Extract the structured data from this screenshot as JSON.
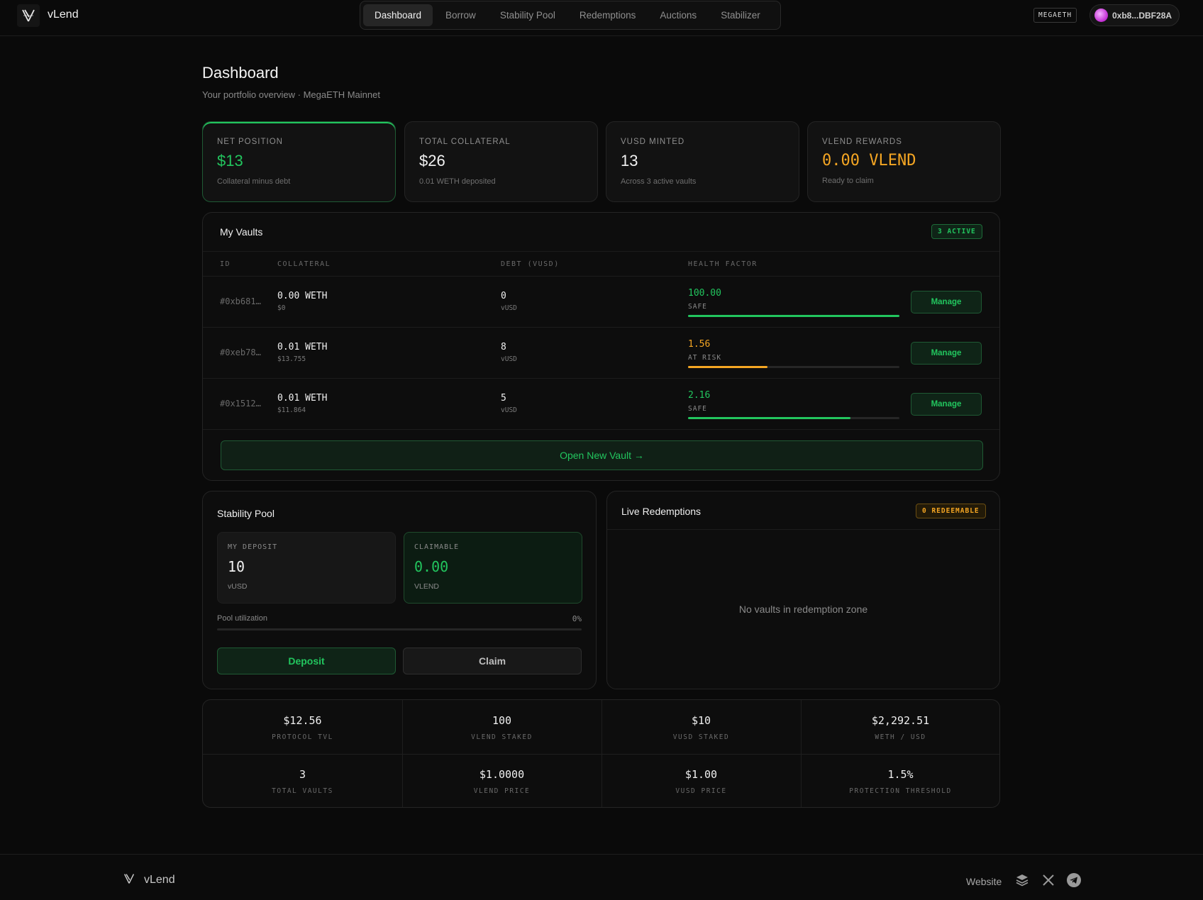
{
  "header": {
    "brand": "vLend",
    "nav": [
      "Dashboard",
      "Borrow",
      "Stability Pool",
      "Redemptions",
      "Auctions",
      "Stabilizer"
    ],
    "network": "MEGAETH",
    "wallet": "0xb8...DBF28A"
  },
  "page": {
    "title": "Dashboard",
    "subtitle": "Your portfolio overview · MegaETH Mainnet"
  },
  "cards": [
    {
      "label": "NET POSITION",
      "value": "$13",
      "sub": "Collateral minus debt"
    },
    {
      "label": "TOTAL COLLATERAL",
      "value": "$26",
      "sub": "0.01 WETH deposited"
    },
    {
      "label": "VUSD MINTED",
      "value": "13",
      "sub": "Across 3 active vaults"
    },
    {
      "label": "VLEND REWARDS",
      "value": "0.00 VLEND",
      "sub": "Ready to claim"
    }
  ],
  "vaults": {
    "title": "My Vaults",
    "badge": "3 ACTIVE",
    "columns": [
      "ID",
      "COLLATERAL",
      "DEBT (VUSD)",
      "HEALTH FACTOR"
    ],
    "rows": [
      {
        "id": "#0xb681…",
        "collateral": "0.00 WETH",
        "collateral_usd": "$0",
        "debt": "0",
        "debt_unit": "vUSD",
        "hf": "100.00",
        "status": "SAFE",
        "hf_fill": 1.0,
        "action": "Manage"
      },
      {
        "id": "#0xeb78…",
        "collateral": "0.01 WETH",
        "collateral_usd": "$13.755",
        "debt": "8",
        "debt_unit": "vUSD",
        "hf": "1.56",
        "status": "AT RISK",
        "hf_fill": 0.375,
        "action": "Manage"
      },
      {
        "id": "#0x1512…",
        "collateral": "0.01 WETH",
        "collateral_usd": "$11.864",
        "debt": "5",
        "debt_unit": "vUSD",
        "hf": "2.16",
        "status": "SAFE",
        "hf_fill": 0.77,
        "action": "Manage"
      }
    ],
    "open_button": "Open New Vault →"
  },
  "pool": {
    "title": "Stability Pool",
    "deposit_label": "MY DEPOSIT",
    "deposit_value": "10",
    "deposit_unit": "vUSD",
    "claim_label": "CLAIMABLE",
    "claim_value": "0.00",
    "claim_unit": "VLEND",
    "util_label": "Pool utilization",
    "util_value": "0%",
    "util_fill": 0,
    "deposit_btn": "Deposit",
    "claim_btn": "Claim"
  },
  "redemptions": {
    "title": "Live Redemptions",
    "badge": "0 REDEEMABLE",
    "empty": "No vaults in redemption zone"
  },
  "stats": [
    {
      "value": "$12.56",
      "label": "PROTOCOL TVL"
    },
    {
      "value": "100",
      "label": "VLEND STAKED"
    },
    {
      "value": "$10",
      "label": "VUSD STAKED"
    },
    {
      "value": "$2,292.51",
      "label": "WETH / USD"
    },
    {
      "value": "3",
      "label": "TOTAL VAULTS"
    },
    {
      "value": "$1.0000",
      "label": "VLEND PRICE"
    },
    {
      "value": "$1.00",
      "label": "VUSD PRICE"
    },
    {
      "value": "1.5%",
      "label": "PROTECTION THRESHOLD"
    }
  ],
  "footer": {
    "brand": "vLend",
    "website": "Website",
    "icons": [
      "layers-icon",
      "x-icon",
      "telegram-icon"
    ]
  },
  "colors": {
    "accent_green": "#22c55e",
    "accent_gold": "#f5a623",
    "background": "#0a0a0a"
  }
}
